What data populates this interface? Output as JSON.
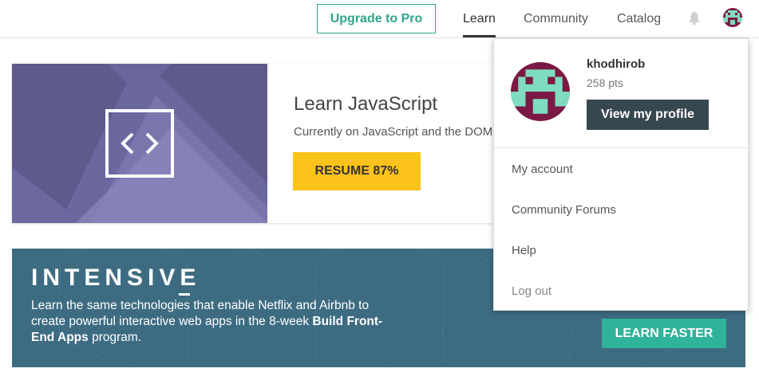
{
  "header": {
    "upgrade_label": "Upgrade to Pro",
    "nav": [
      {
        "label": "Learn",
        "active": true
      },
      {
        "label": "Community",
        "active": false
      },
      {
        "label": "Catalog",
        "active": false
      }
    ],
    "icons": [
      "bell-icon",
      "avatar"
    ]
  },
  "course": {
    "title": "Learn JavaScript",
    "subtitle": "Currently on JavaScript and the DOM",
    "resume_label": "RESUME 87%",
    "progress_percent": 87,
    "icon": "code-brackets-icon"
  },
  "intensive": {
    "title": "INTENSIVE",
    "text_before": "Learn the same technologies that enable Netflix and Airbnb to create powerful interactive web apps in the 8-week ",
    "text_bold": "Build Front-End Apps",
    "text_after": " program.",
    "cta_label": "LEARN FASTER"
  },
  "dropdown": {
    "username": "khodhirob",
    "points": "258 pts",
    "profile_button": "View my profile",
    "items": [
      "My account",
      "Community Forums",
      "Help",
      "Log out"
    ]
  },
  "colors": {
    "accent": "#2fa58d",
    "resume": "#fbc21b",
    "profile_button": "#37474f",
    "avatar_bg": "#7a1a44",
    "avatar_fg": "#7fdcc0"
  }
}
